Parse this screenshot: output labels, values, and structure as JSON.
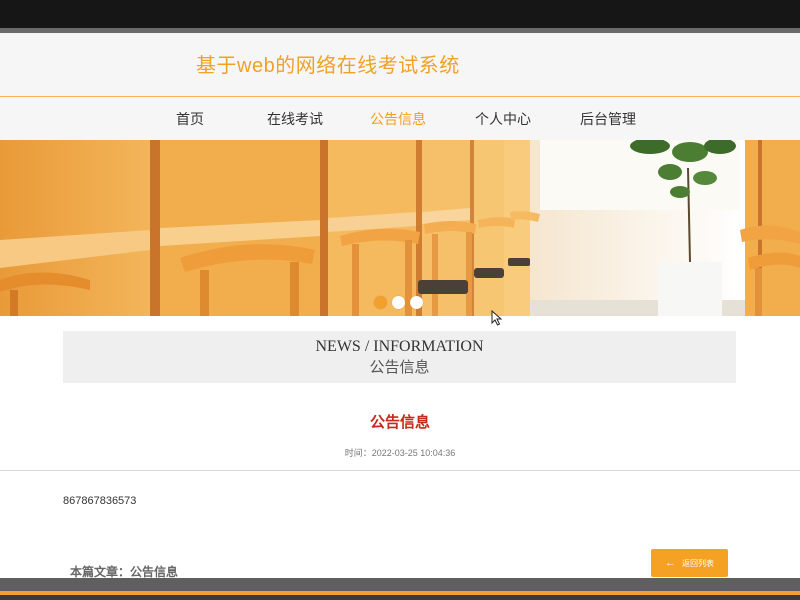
{
  "site": {
    "title": "基于web的网络在线考试系统"
  },
  "nav": {
    "items": [
      {
        "label": "首页"
      },
      {
        "label": "在线考试"
      },
      {
        "label": "公告信息"
      },
      {
        "label": "个人中心"
      },
      {
        "label": "后台管理"
      }
    ],
    "active_index": 2
  },
  "banner": {
    "slide_count": 3,
    "active_slide": 0
  },
  "section": {
    "title_en": "NEWS / INFORMATION",
    "title_cn": "公告信息"
  },
  "article": {
    "title": "公告信息",
    "time": "时间：2022-03-25 10:04:36",
    "content": "867867836573"
  },
  "footer": {
    "current_label": "本篇文章：公告信息",
    "back_button": "返回列表"
  },
  "colors": {
    "accent": "#f0a227",
    "title_red": "#c42b1c",
    "topbar": "#161616"
  },
  "icons": {
    "back": "arrow-left-icon",
    "cursor": "mouse-cursor-icon"
  }
}
